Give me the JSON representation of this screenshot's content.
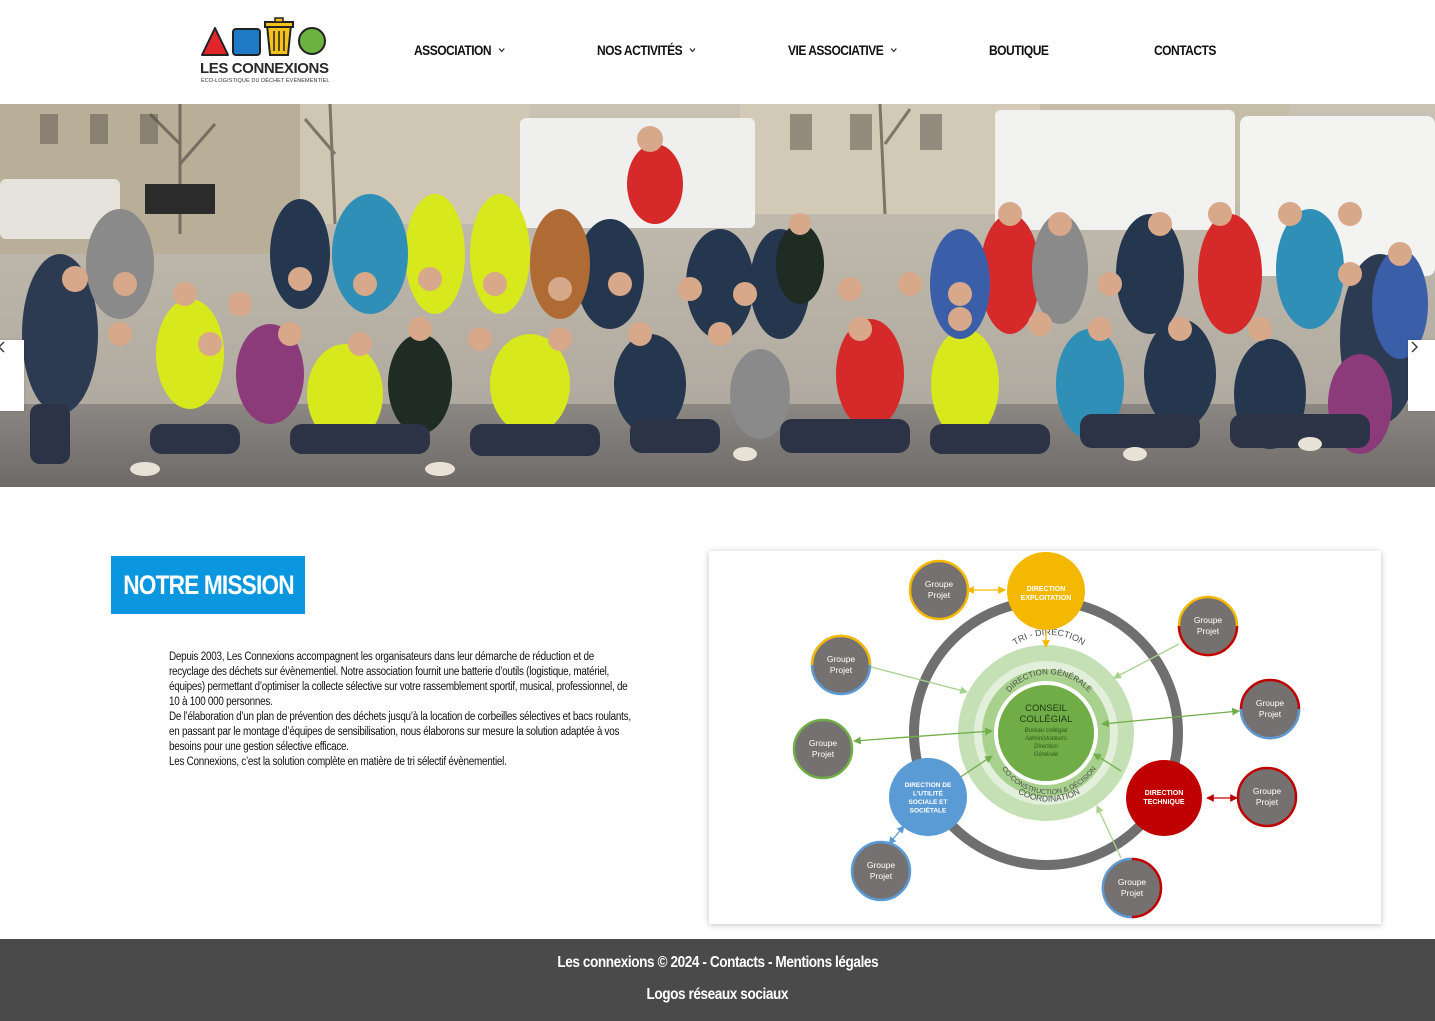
{
  "header": {
    "logo": {
      "title": "LES CONNEXIONS",
      "subtitle": "ÉCO-LOGISTIQUE DU DÉCHET ÉVÉNEMENTIEL",
      "colors": {
        "red": "#e0252b",
        "blue": "#1e7ac4",
        "yellow": "#f6c21a",
        "green": "#6cb33f"
      }
    },
    "nav": [
      {
        "label": "ASSOCIATION",
        "has_dropdown": true
      },
      {
        "label": "NOS ACTIVITÉS",
        "has_dropdown": true
      },
      {
        "label": "VIE ASSOCIATIVE",
        "has_dropdown": true
      },
      {
        "label": "BOUTIQUE",
        "has_dropdown": false
      },
      {
        "label": "CONTACTS",
        "has_dropdown": false
      }
    ]
  },
  "hero": {
    "image": "group-photo-volunteers",
    "prev_icon": "chevron-left-icon",
    "next_icon": "chevron-right-icon"
  },
  "mission": {
    "title": "NOTRE MISSION",
    "paragraphs": [
      "Depuis 2003, Les Connexions accompagnent les organisateurs dans leur démarche de réduction et de recyclage des déchets sur évènementiel. Notre association fournit une batterie d’outils (logistique, matériel, équipes) permettant d’optimiser la collecte sélective sur votre rassemblement sportif, musical, professionnel, de 10 à 100 000 personnes.",
      "De l’élaboration d’un plan de prévention des déchets jusqu’à la location de corbeilles sélectives et bacs roulants, en passant par le montage d’équipes de sensibilisation, nous élaborons sur mesure la solution adaptée à vos besoins pour une gestion sélective efficace.",
      "Les Connexions, c’est la solution complète en matière de tri sélectif évènementiel."
    ]
  },
  "diagram": {
    "center_title": "CONSEIL COLLÉGIAL",
    "center_sub": [
      "Bureau collégial",
      "Administrateurs",
      "Direction",
      "Générale"
    ],
    "ring_labels": {
      "tri": "TRI - DIRECTION",
      "direction_generale": "DIRECTION GÉNÉRALE",
      "construction": "CO-CONSTRUCTION & DÉCISION",
      "coordination": "COORDINATION"
    },
    "directions": {
      "exploitation": [
        "DIRECTION",
        "EXPLOITATION"
      ],
      "technique": [
        "DIRECTION",
        "TECHNIQUE"
      ],
      "utilite": [
        "DIRECTION DE",
        "L’UTILITÉ",
        "SOCIALE ET",
        "SOCIÉTALE"
      ]
    },
    "group_label": [
      "Groupe",
      "Projet"
    ],
    "colors": {
      "yellow": "#f5b800",
      "red": "#c00000",
      "blue": "#5b9bd5",
      "green": "#70ad47",
      "grey": "#767171",
      "ring": "#6f6f6f"
    }
  },
  "footer": {
    "brand": "Les connexions © 2024",
    "sep": " - ",
    "contacts": "Contacts",
    "legal": "Mentions légales",
    "social": "Logos réseaux sociaux"
  }
}
